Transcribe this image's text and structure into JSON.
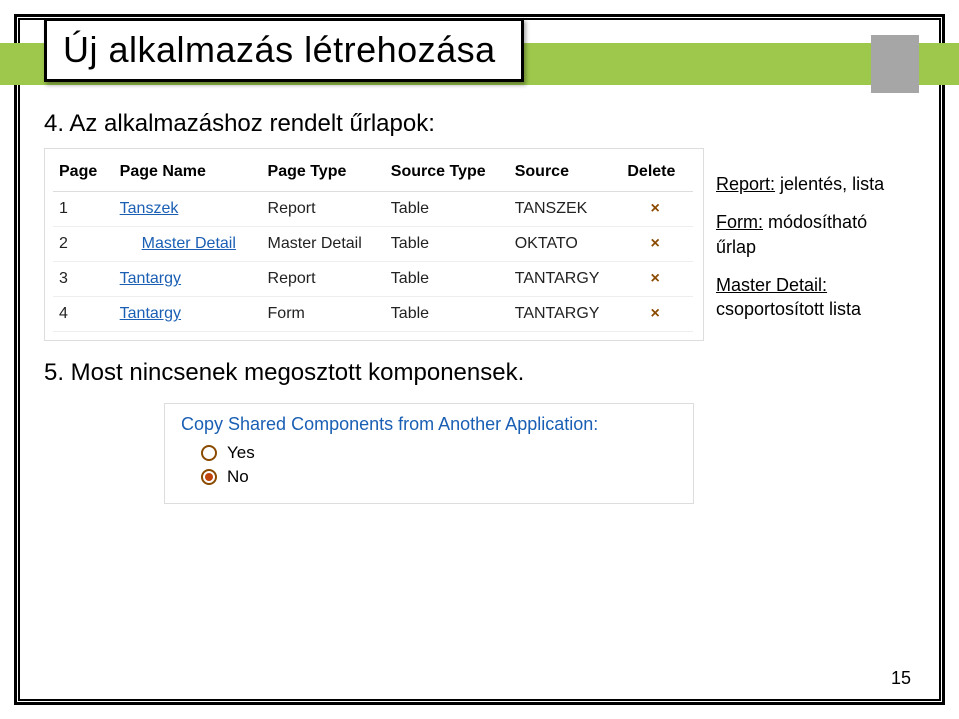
{
  "title": "Új alkalmazás létrehozása",
  "bullet4": "4. Az alkalmazáshoz rendelt űrlapok:",
  "bullet5": "5. Most nincsenek megosztott komponensek.",
  "page_number": "15",
  "table": {
    "headers": {
      "page": "Page",
      "name": "Page Name",
      "type": "Page Type",
      "src_type": "Source Type",
      "src": "Source",
      "del": "Delete"
    },
    "rows": [
      {
        "n": "1",
        "name": "Tanszek",
        "indent": false,
        "ptype": "Report",
        "stype": "Table",
        "src": "TANSZEK",
        "del": "×"
      },
      {
        "n": "2",
        "name": "Master Detail",
        "indent": true,
        "ptype": "Master Detail",
        "stype": "Table",
        "src": "OKTATO",
        "del": "×"
      },
      {
        "n": "3",
        "name": "Tantargy",
        "indent": false,
        "ptype": "Report",
        "stype": "Table",
        "src": "TANTARGY",
        "del": "×"
      },
      {
        "n": "4",
        "name": "Tantargy",
        "indent": false,
        "ptype": "Form",
        "stype": "Table",
        "src": "TANTARGY",
        "del": "×"
      }
    ]
  },
  "legend": {
    "report": {
      "title": "Report:",
      "body": "jelentés, lista"
    },
    "form": {
      "title": "Form:",
      "body": "módosítható űrlap"
    },
    "master": {
      "title": "Master Detail:",
      "body": "csoportosított lista"
    }
  },
  "shared": {
    "label": "Copy Shared Components from Another Application:",
    "yes": "Yes",
    "no": "No"
  }
}
